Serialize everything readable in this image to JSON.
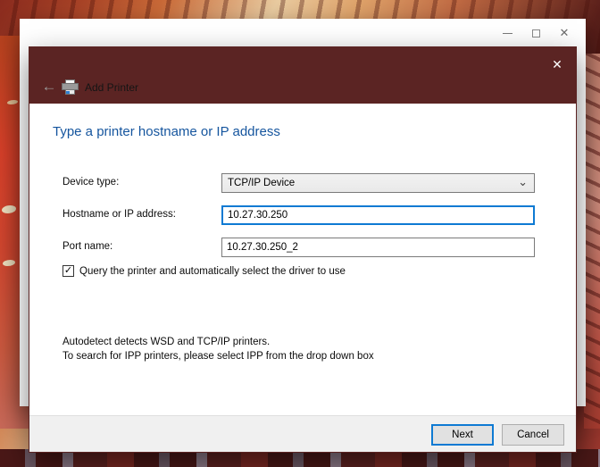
{
  "parent_window": {
    "minimize_glyph": "",
    "close_glyph": "✕"
  },
  "dialog": {
    "title": "Add Printer",
    "close_glyph": "✕",
    "back_glyph": "←",
    "heading": "Type a printer hostname or IP address",
    "device_type": {
      "label": "Device type:",
      "value": "TCP/IP Device",
      "chevron_glyph": "⌄"
    },
    "hostname": {
      "label": "Hostname or IP address:",
      "value": "10.27.30.250"
    },
    "port_name": {
      "label": "Port name:",
      "value": "10.27.30.250_2"
    },
    "query_checkbox": {
      "label": "Query the printer and automatically select the driver to use",
      "checked": true,
      "check_glyph": "✓"
    },
    "info_line1": "Autodetect detects WSD and TCP/IP printers.",
    "info_line2": "To search for IPP printers, please select IPP from the drop down box",
    "next_label": "Next",
    "cancel_label": "Cancel"
  },
  "colors": {
    "accent_maroon": "#5b2423",
    "heading_blue": "#15559e",
    "focus_blue": "#0e7ad3",
    "footer_gray": "#f0f0f0"
  }
}
